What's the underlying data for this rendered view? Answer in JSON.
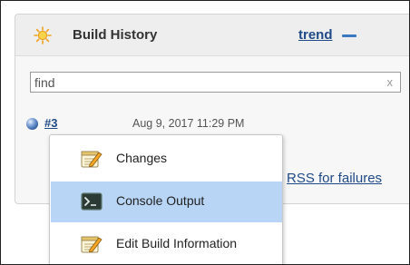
{
  "panel": {
    "title": "Build History",
    "trend_label": "trend"
  },
  "search": {
    "placeholder": "find",
    "clear_label": "x"
  },
  "builds": [
    {
      "number": "#3",
      "date": "Aug 9, 2017 11:29 PM",
      "status_color": "#2f5a9e"
    }
  ],
  "footer": {
    "rss_failures_label": "RSS for failures"
  },
  "context_menu": {
    "items": [
      {
        "label": "Changes",
        "icon": "notepad-icon"
      },
      {
        "label": "Console Output",
        "icon": "terminal-icon",
        "selected": true
      },
      {
        "label": "Edit Build Information",
        "icon": "notepad-icon"
      }
    ]
  },
  "colors": {
    "link": "#204a87",
    "selected_menu_bg": "#b8d5f5",
    "header_bg": "#eeeeee"
  }
}
